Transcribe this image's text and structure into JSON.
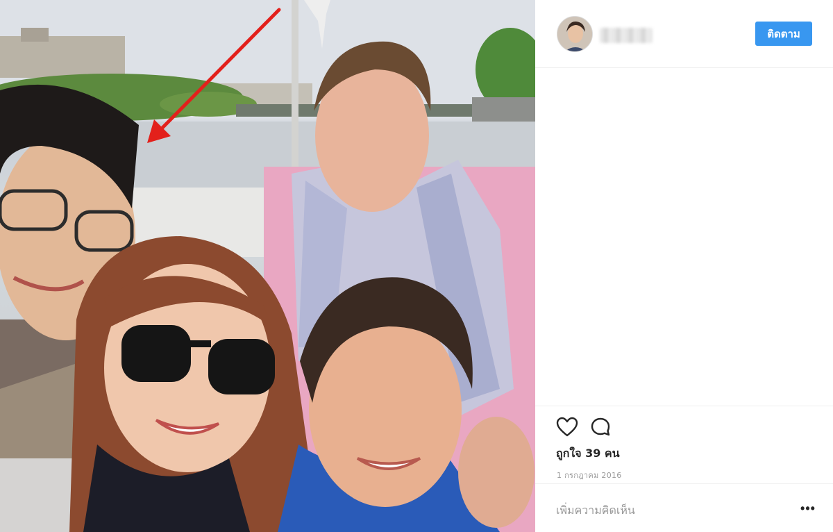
{
  "post": {
    "photo_alt": "photo",
    "username_hidden": true,
    "follow_label": "ติดตาม",
    "likes_text": "ถูกใจ 39 คน",
    "date_text": "1 กรกฎาคม 2016",
    "comment_placeholder": "เพิ่มความคิดเห็น",
    "more_label": "•••"
  },
  "icons": {
    "like": "heart-icon",
    "comment": "comment-icon",
    "annotation": "red-arrow-icon"
  },
  "colors": {
    "follow_button": "#3897f0",
    "arrow": "#e3201b",
    "divider": "#efefef"
  }
}
